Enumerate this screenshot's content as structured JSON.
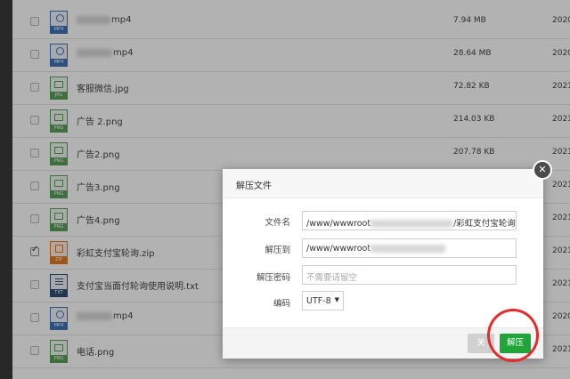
{
  "files": [
    {
      "icon": "vid",
      "icon_label": "MP4",
      "name": "mp4",
      "blurred": true,
      "size": "7.94 MB",
      "date": "2020",
      "checked": false
    },
    {
      "icon": "vid",
      "icon_label": "MP4",
      "name": "mp4",
      "blurred": true,
      "size": "28.64 MB",
      "date": "2020",
      "checked": false
    },
    {
      "icon": "img",
      "icon_label": "JPG",
      "name": "客服微信.jpg",
      "blurred": false,
      "size": "72.82 KB",
      "date": "2021",
      "checked": false
    },
    {
      "icon": "img",
      "icon_label": "PNG",
      "name": "广告 2.png",
      "blurred": false,
      "size": "214.03 KB",
      "date": "2021",
      "checked": false
    },
    {
      "icon": "img",
      "icon_label": "PNG",
      "name": "广告2.png",
      "blurred": false,
      "size": "207.78 KB",
      "date": "2021",
      "checked": false
    },
    {
      "icon": "img",
      "icon_label": "PNG",
      "name": "广告3.png",
      "blurred": false,
      "size": "",
      "date": "2021",
      "checked": false
    },
    {
      "icon": "img",
      "icon_label": "PNG",
      "name": "广告4.png",
      "blurred": false,
      "size": "",
      "date": "2021",
      "checked": false
    },
    {
      "icon": "zip",
      "icon_label": "ZIP",
      "name": "彩虹支付宝轮询.zip",
      "blurred": false,
      "size": "",
      "date": "2021",
      "checked": true
    },
    {
      "icon": "txt",
      "icon_label": "TXT",
      "name": "支付宝当面付轮询使用说明.txt",
      "blurred": false,
      "size": "",
      "date": "2021",
      "checked": false
    },
    {
      "icon": "vid",
      "icon_label": "MP4",
      "name": "mp4",
      "blurred": true,
      "size": "",
      "date": "2020",
      "checked": false
    },
    {
      "icon": "img",
      "icon_label": "PNG",
      "name": "电话.png",
      "blurred": false,
      "size": "",
      "date": "2021",
      "checked": false
    }
  ],
  "dialog": {
    "title": "解压文件",
    "filename_label": "文件名",
    "filename_prefix": "/www/wwwroot",
    "filename_suffix": "/彩虹支付宝轮询.zip",
    "extract_to_label": "解压到",
    "extract_to_prefix": "/www/wwwroot",
    "password_label": "解压密码",
    "password_placeholder": "不需要请留空",
    "encoding_label": "编码",
    "encoding_value": "UTF-8",
    "cancel_label": "关",
    "ok_label": "解压",
    "close_glyph": "✕"
  },
  "colors": {
    "ok_button": "#20a53a",
    "annotation_ring": "#e52b2b"
  }
}
